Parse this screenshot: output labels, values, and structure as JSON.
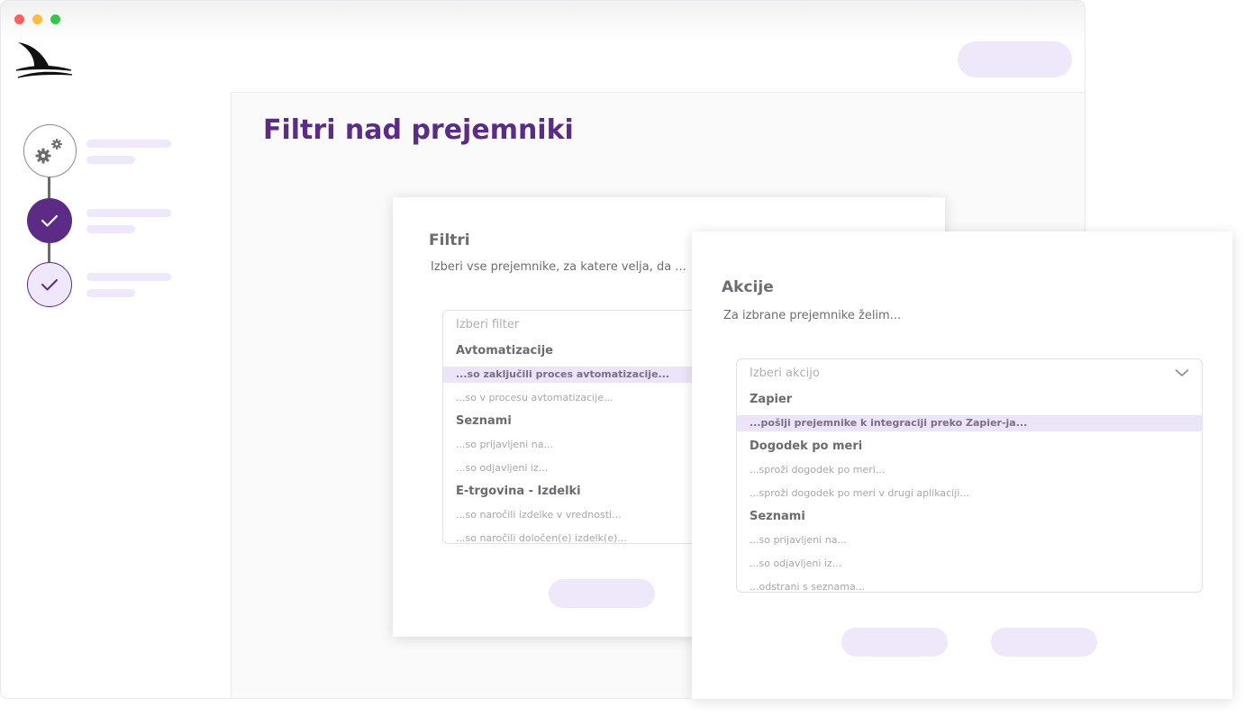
{
  "page": {
    "title": "Filtri nad prejemniki"
  },
  "filters_card": {
    "title": "Filtri",
    "subtitle": "Izberi vse prejemnike, za katere velja, da ...",
    "dropdown": {
      "placeholder": "Izberi filter",
      "groups": [
        {
          "label": "Avtomatizacije",
          "options": [
            {
              "label": "...so zaključili proces avtomatizacije...",
              "selected": true
            },
            {
              "label": "...so v procesu avtomatizacije...",
              "selected": false
            }
          ]
        },
        {
          "label": "Seznami",
          "options": [
            {
              "label": "...so prijavljeni na...",
              "selected": false
            },
            {
              "label": "...so odjavljeni iz...",
              "selected": false
            }
          ]
        },
        {
          "label": "E-trgovina - Izdelki",
          "options": [
            {
              "label": "...so naročili izdelke v vrednosti...",
              "selected": false
            },
            {
              "label": "...so naročili določen(e) izdelk(e)...",
              "selected": false
            }
          ]
        }
      ]
    }
  },
  "actions_card": {
    "title": "Akcije",
    "subtitle": "Za izbrane prejemnike želim...",
    "dropdown": {
      "placeholder": "Izberi akcijo",
      "icon": "chevron-down-icon",
      "groups": [
        {
          "label": "Zapier",
          "options": [
            {
              "label": "...pošlji prejemnike k integraciji preko Zapier-ja...",
              "selected": true
            }
          ]
        },
        {
          "label": "Dogodek po meri",
          "options": [
            {
              "label": "...sproži dogodek po meri...",
              "selected": false
            },
            {
              "label": "...sproži dogodek po meri v drugi aplikaciji...",
              "selected": false
            }
          ]
        },
        {
          "label": "Seznami",
          "options": [
            {
              "label": "...so prijavljeni na...",
              "selected": false
            },
            {
              "label": "...so odjavljeni iz...",
              "selected": false
            },
            {
              "label": "...odstrani s seznama...",
              "selected": false
            }
          ]
        }
      ]
    }
  },
  "sidebar": {
    "steps": [
      {
        "state": "settings",
        "icon": "gears-icon"
      },
      {
        "state": "completed",
        "icon": "check-icon"
      },
      {
        "state": "active",
        "icon": "check-icon"
      }
    ]
  },
  "colors": {
    "brand": "#5b2b86",
    "skeleton": "#efe8fa",
    "selected_option": "#ece4f8",
    "text_muted": "#6e6c72"
  }
}
